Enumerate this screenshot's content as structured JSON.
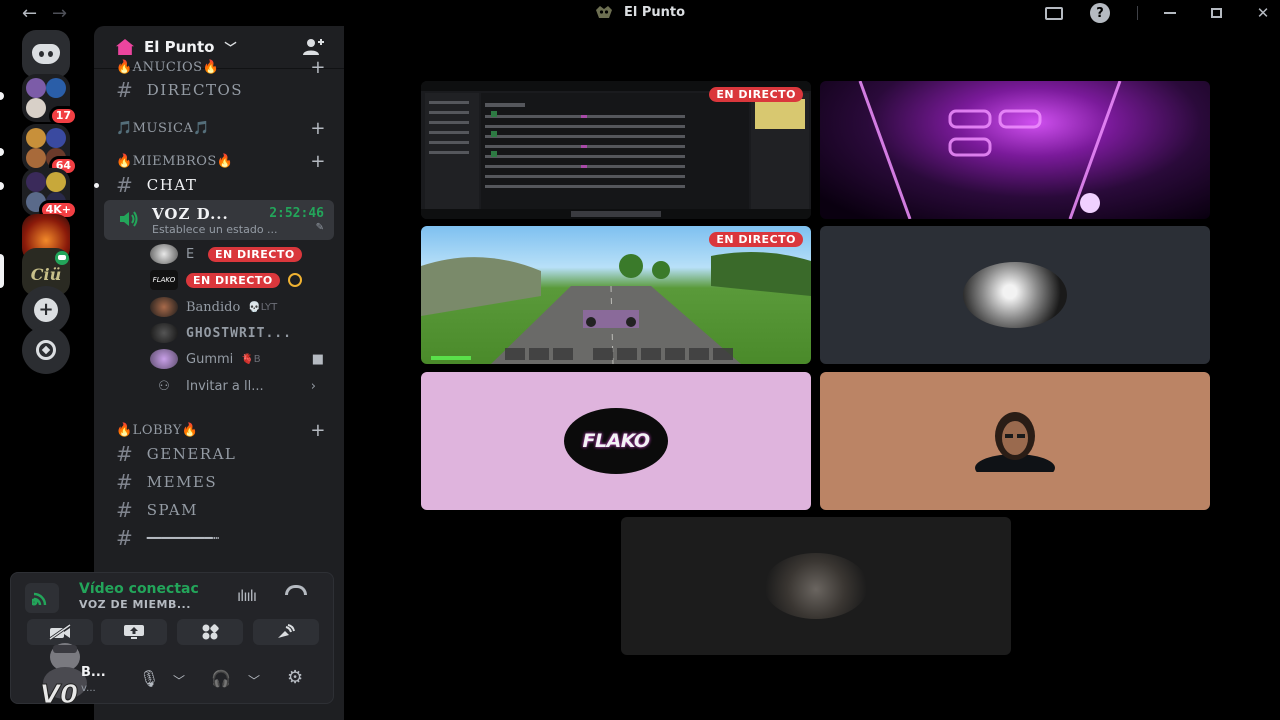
{
  "window": {
    "title": "El Punto"
  },
  "rail": {
    "folder1_badge": "17",
    "folder2_badge": "64",
    "folder3_badge": "4K+"
  },
  "server": {
    "name": "El Punto"
  },
  "categories": {
    "anuncios": "🔥ANUCIOS🔥",
    "musica": "🎵MUSICA🎵",
    "miembros": "🔥MIEMBROS🔥",
    "lobby": "🔥LOBBY🔥"
  },
  "channels": {
    "directos": "DIRECTOS",
    "chat": "CHAT",
    "general": "GENERAL",
    "memes": "MEMES",
    "spam": "SPAM",
    "divider": "━━━━━━━━━┉"
  },
  "voice_channel": {
    "name": "VOZ D...",
    "timer": "2:52:46",
    "status": "Establece un estado ..."
  },
  "members": [
    {
      "name": "E",
      "live": "EN DIRECTO"
    },
    {
      "name": "FLAKO",
      "live": "EN DIRECTO"
    },
    {
      "name": "Bandido",
      "activity": "💀LYT"
    },
    {
      "name": "GHOSTWRIT..."
    },
    {
      "name": "Gummi",
      "activity": "🫀B"
    },
    {
      "name": "Invitar a ll..."
    }
  ],
  "voice_panel": {
    "title": "Vídeo conectac",
    "subtitle": "VOZ DE MIEMB...",
    "user_name": "B...",
    "user_status": "v..."
  },
  "stage": {
    "live_label": "EN DIRECTO",
    "flako_logo": "FLAKO"
  },
  "colors": {
    "accent_green": "#23a55a",
    "live_red": "#da373c",
    "background": "#000000",
    "sidebar": "#1e1f22"
  }
}
